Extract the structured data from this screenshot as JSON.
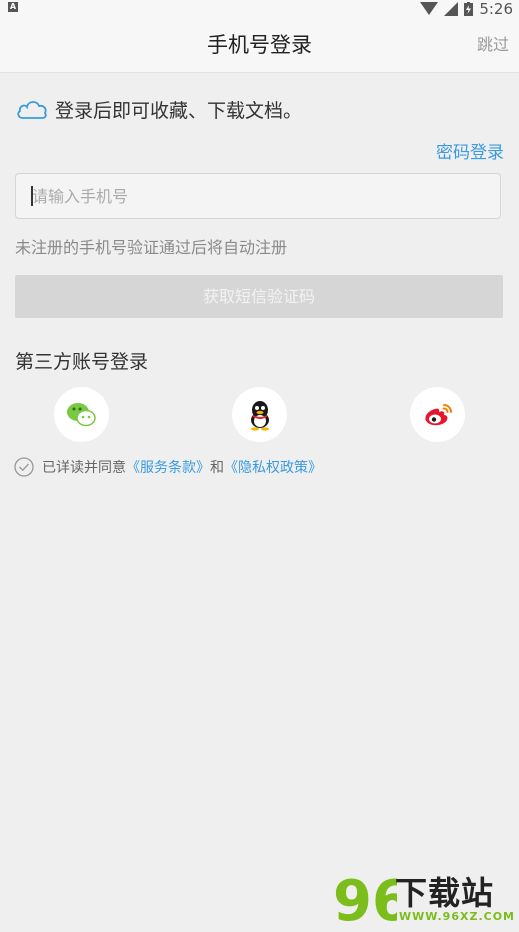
{
  "status_bar": {
    "left_icon_letter": "A",
    "time": "5:26"
  },
  "header": {
    "title": "手机号登录",
    "skip_label": "跳过"
  },
  "notice": {
    "text": "登录后即可收藏、下载文档。",
    "icon": "cloud-icon"
  },
  "password_login_label": "密码登录",
  "phone_input": {
    "placeholder": "请输入手机号",
    "value": ""
  },
  "hint_text": "未注册的手机号验证通过后将自动注册",
  "get_code_button_label": "获取短信验证码",
  "third_party": {
    "title": "第三方账号登录",
    "providers": [
      {
        "name": "wechat",
        "icon": "wechat-icon",
        "color": "#7ac943"
      },
      {
        "name": "qq",
        "icon": "qq-penguin-icon",
        "color": "#1a1a1a"
      },
      {
        "name": "weibo",
        "icon": "weibo-icon",
        "color": "#e6162d"
      }
    ]
  },
  "agreement": {
    "prefix": "已详读并同意",
    "terms_link": "《服务条款》",
    "conjunction": "和",
    "privacy_link": "《隐私权政策》"
  },
  "watermark": {
    "text": "下载站",
    "number": "96",
    "url": "WWW.96XZ.COM"
  },
  "colors": {
    "accent": "#3a9be0",
    "disabled_button": "#d6d6d6",
    "background": "#efefef"
  }
}
